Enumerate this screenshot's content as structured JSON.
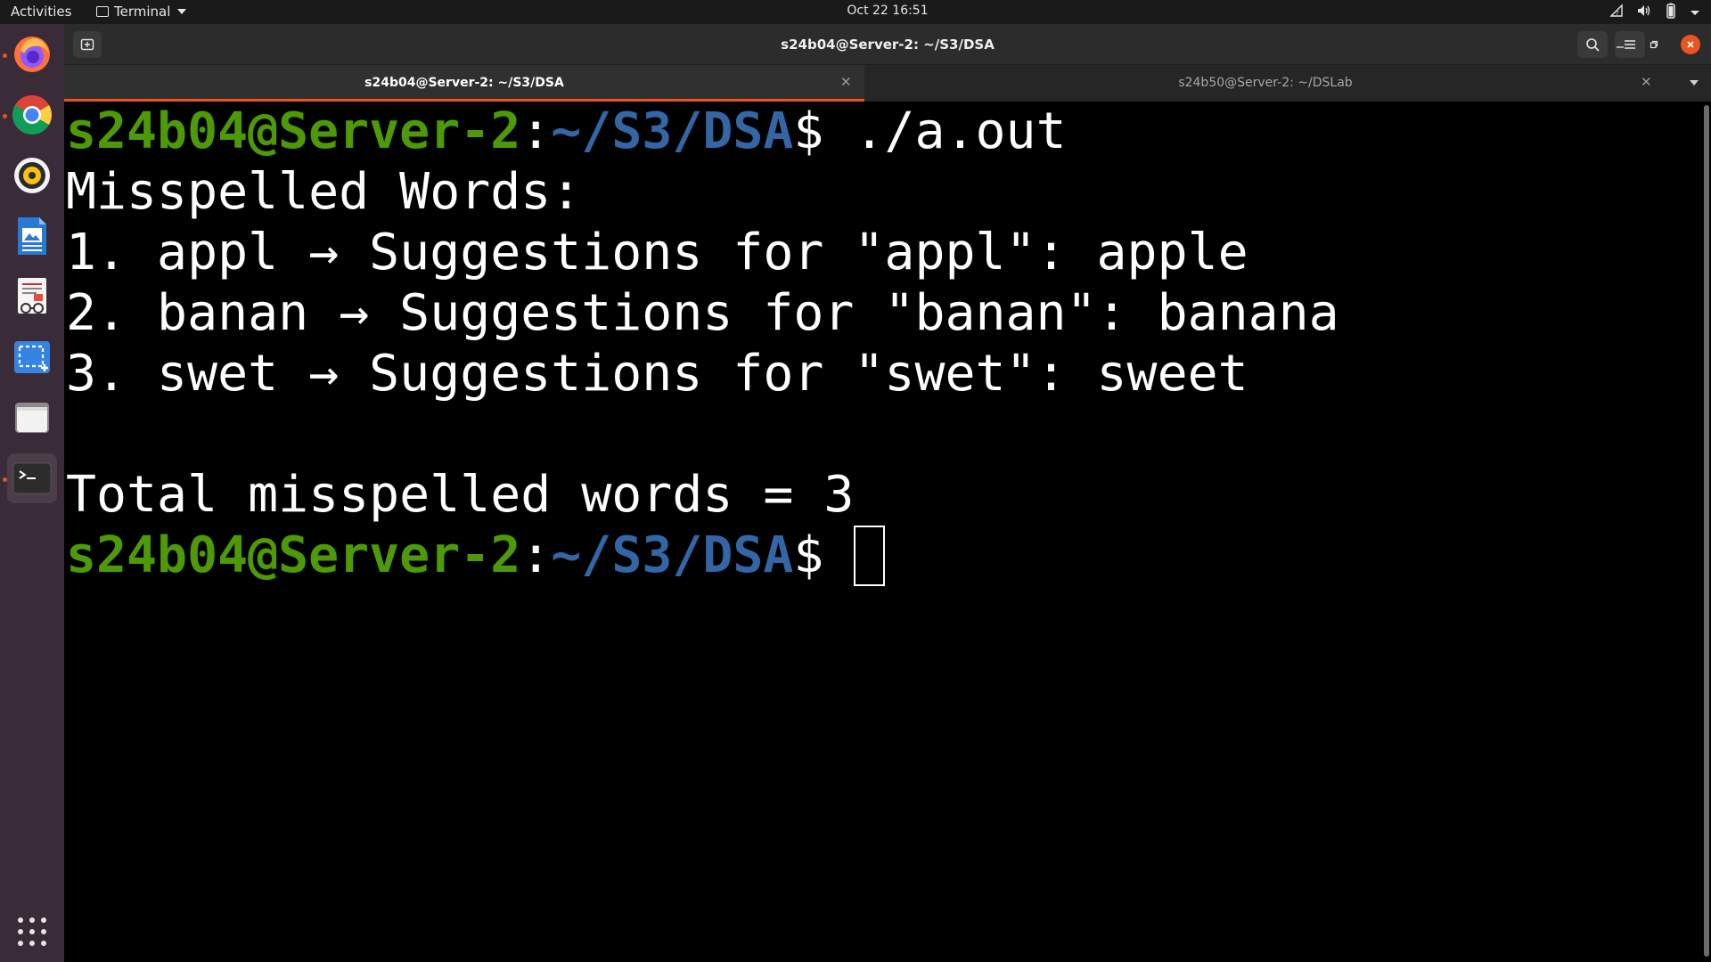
{
  "topbar": {
    "activities": "Activities",
    "app_menu": "Terminal",
    "clock": "Oct 22  16:51",
    "tray_icons": [
      "network-icon",
      "volume-icon",
      "battery-icon",
      "system-menu-icon"
    ]
  },
  "dock": {
    "items": [
      "firefox-icon",
      "chrome-icon",
      "rhythmbox-icon",
      "writer-icon",
      "document-viewer-icon",
      "screenshot-icon",
      "files-icon",
      "terminal-icon"
    ],
    "running": [
      "firefox-icon",
      "chrome-icon",
      "terminal-icon"
    ],
    "active": "terminal-icon",
    "show_apps": "grid-icon"
  },
  "window": {
    "title": "s24b04@Server-2: ~/S3/DSA"
  },
  "tabs": [
    {
      "label": "s24b04@Server-2: ~/S3/DSA",
      "active": true
    },
    {
      "label": "s24b50@Server-2: ~/DSLab",
      "active": false
    }
  ],
  "terminal": {
    "prompt_user": "s24b04@Server-2",
    "prompt_sep": ":",
    "prompt_path": "~/S3/DSA",
    "prompt_symbol": "$ ",
    "command": "./a.out",
    "output": [
      "Misspelled Words:",
      "1. appl → Suggestions for \"appl\": apple",
      "2. banan → Suggestions for \"banan\": banana",
      "3. swet → Suggestions for \"swet\": sweet",
      "",
      "Total misspelled words = 3"
    ]
  },
  "colors": {
    "accent": "#e95420",
    "prompt_user": "#4e9a06",
    "prompt_path": "#3465a4",
    "dock_bg": "#3a2b38"
  }
}
